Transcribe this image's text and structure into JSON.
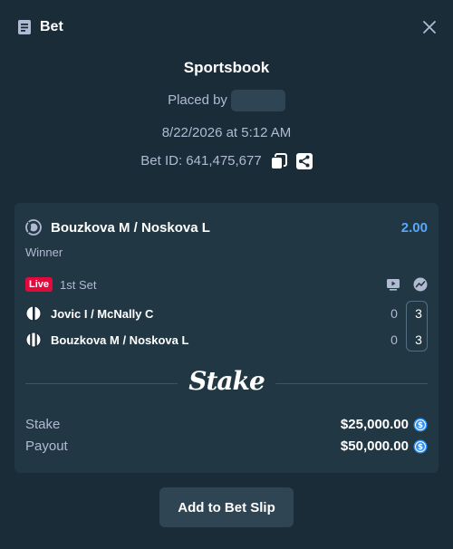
{
  "header": {
    "title": "Bet",
    "icon": "receipt-icon",
    "close_icon": "close-icon"
  },
  "meta": {
    "book": "Sportsbook",
    "placed_by_label": "Placed by",
    "date": "8/22/2026 at 5:12 AM",
    "bet_id": "Bet ID: 641,475,677"
  },
  "bet": {
    "match": "Bouzkova M / Noskova L",
    "odds": "2.00",
    "market": "Winner",
    "live_label": "Live",
    "period": "1st Set",
    "teams": [
      {
        "name": "Jovic I / McNally C",
        "games": "0",
        "sets": "3"
      },
      {
        "name": "Bouzkova M / Noskova L",
        "games": "0",
        "sets": "3"
      }
    ],
    "logo": "Stake",
    "stake_label": "Stake",
    "stake_value": "$25,000.00",
    "payout_label": "Payout",
    "payout_value": "$50,000.00"
  },
  "actions": {
    "add_to_slip": "Add to Bet Slip"
  },
  "colors": {
    "background": "#1a2c38",
    "card": "#213743",
    "odds": "#56a8ff",
    "live": "#e20a3c",
    "coin": "#2d8ff5"
  }
}
